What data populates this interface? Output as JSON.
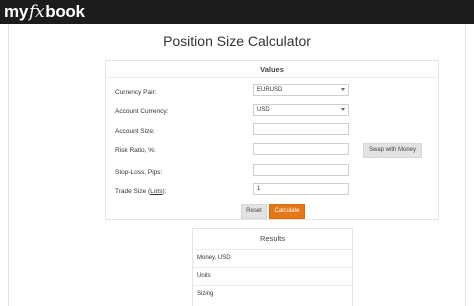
{
  "brand": {
    "logo_left": "my",
    "logo_fx": "fx",
    "logo_right": "book"
  },
  "page": {
    "title": "Position Size Calculator"
  },
  "values": {
    "header": "Values",
    "currency_pair": {
      "label": "Currency Pair:",
      "value": "EURUSD"
    },
    "account_currency": {
      "label": "Account Currency:",
      "value": "USD"
    },
    "account_size": {
      "label": "Account Size:",
      "value": ""
    },
    "risk_ratio": {
      "label": "Risk Ratio, %:",
      "value": ""
    },
    "swap_button": "Swap with Money",
    "stop_loss": {
      "label": "Stop-Loss, Pips:",
      "value": ""
    },
    "trade_size": {
      "label_prefix": "Trade Size (",
      "label_link": "Lots",
      "label_suffix": "):",
      "value": "1"
    },
    "reset_button": "Reset",
    "calculate_button": "Calculate"
  },
  "results": {
    "header": "Results",
    "rows": [
      "Money, USD",
      "Units",
      "Sizing"
    ]
  },
  "colors": {
    "topbar": "#1c1c1c",
    "accent": "#e67716",
    "button_gray": "#e3e3e3"
  }
}
